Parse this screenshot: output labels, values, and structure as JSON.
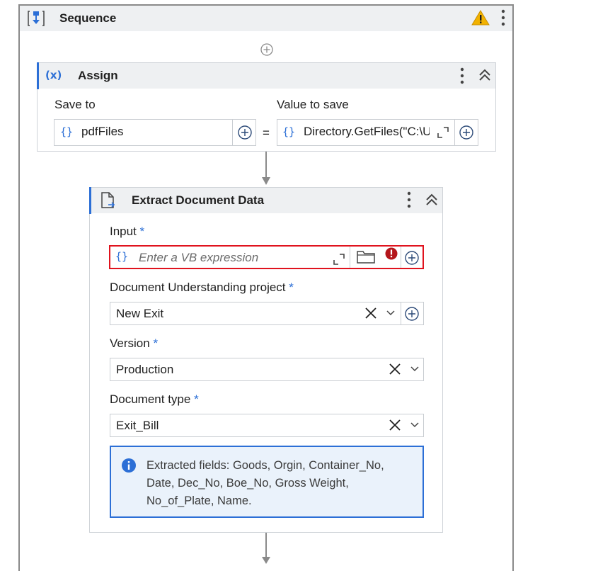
{
  "sequence": {
    "title": "Sequence",
    "icons": [
      "sequence-icon",
      "warning-icon",
      "more-icon"
    ]
  },
  "assign": {
    "title": "Assign",
    "icon_text": "(x)",
    "save_to_label": "Save to",
    "value_to_save_label": "Value to save",
    "save_to_value": "pdfFiles",
    "equals": "=",
    "value": "Directory.GetFiles(\"C:\\U",
    "braces": "{}"
  },
  "extract": {
    "title": "Extract Document Data",
    "input_label": "Input",
    "input_placeholder": "Enter a VB expression",
    "project_label": "Document Understanding project",
    "project_value": "New Exit",
    "version_label": "Version",
    "version_value": "Production",
    "doctype_label": "Document type",
    "doctype_value": "Exit_Bill",
    "required_mark": "*",
    "info_line1": "Extracted fields: Goods, Orgin, Container_No,",
    "info_line2": "Date, Dec_No, Boe_No, Gross Weight,",
    "info_line3": "No_of_Plate, Name.",
    "braces": "{}"
  },
  "colors": {
    "accent": "#2c6fd6",
    "error": "#e0131e",
    "warning": "#f2b200",
    "info_bg": "#eaf2fb"
  }
}
